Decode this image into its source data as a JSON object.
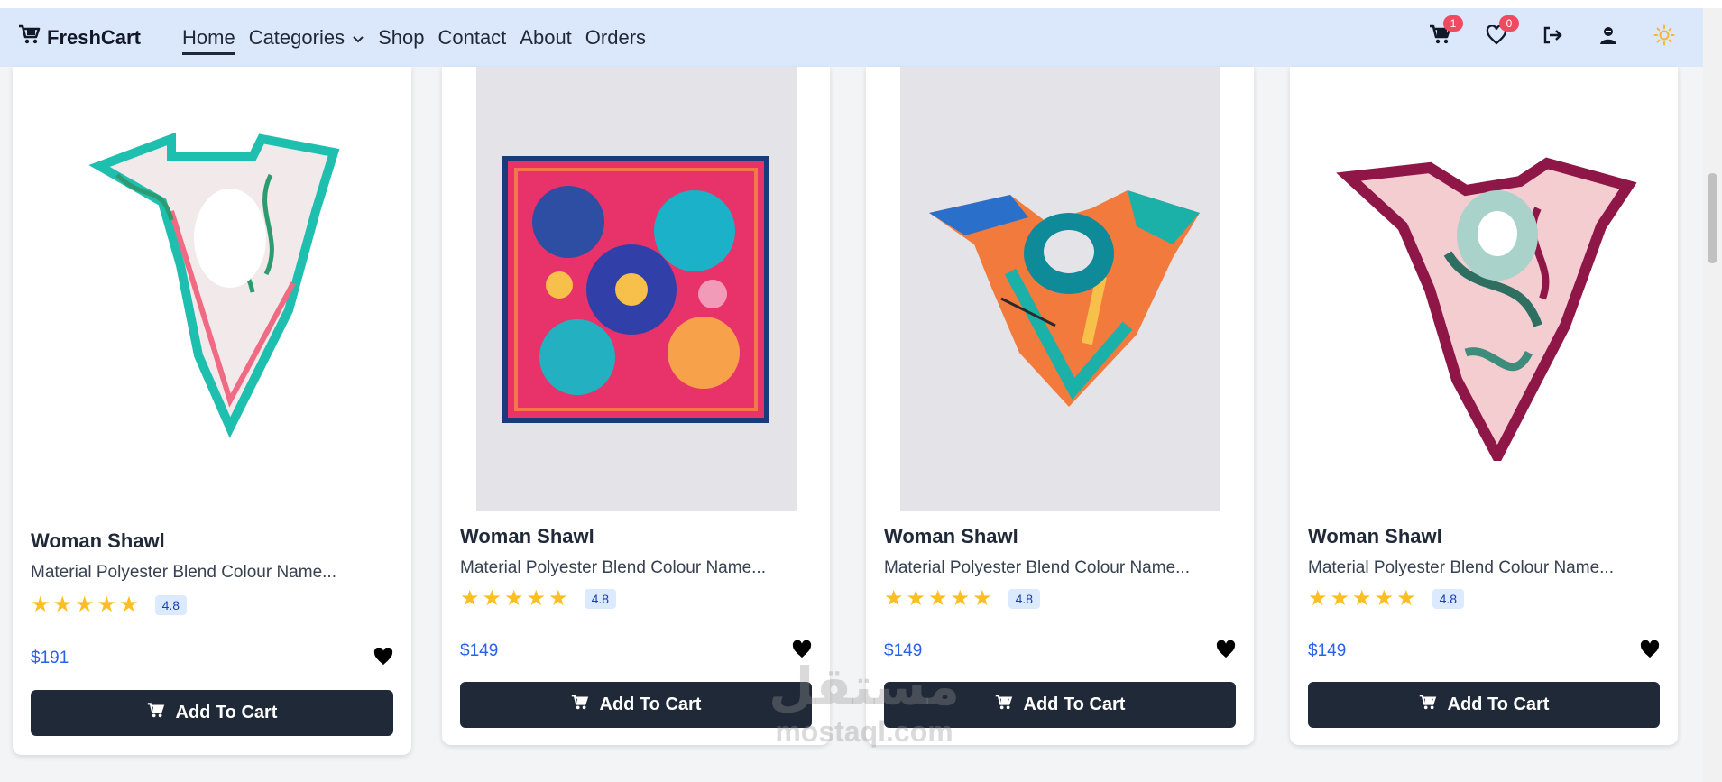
{
  "brand": {
    "name": "FreshCart"
  },
  "nav": {
    "links": [
      "Home",
      "Categories",
      "Shop",
      "Contact",
      "About",
      "Orders"
    ],
    "active": "Home"
  },
  "header_icons": {
    "cart_count": "1",
    "wishlist_count": "0",
    "icons": [
      "cart-icon",
      "heart-icon",
      "logout-icon",
      "user-icon",
      "sun-icon"
    ]
  },
  "products": [
    {
      "title": "Woman Shawl",
      "description": "Material Polyester Blend Colour Name...",
      "rating": "4.8",
      "price": "$191",
      "button": "Add To Cart"
    },
    {
      "title": "Woman Shawl",
      "description": "Material Polyester Blend Colour Name...",
      "rating": "4.8",
      "price": "$149",
      "button": "Add To Cart"
    },
    {
      "title": "Woman Shawl",
      "description": "Material Polyester Blend Colour Name...",
      "rating": "4.8",
      "price": "$149",
      "button": "Add To Cart"
    },
    {
      "title": "Woman Shawl",
      "description": "Material Polyester Blend Colour Name...",
      "rating": "4.8",
      "price": "$149",
      "button": "Add To Cart"
    }
  ],
  "watermark": {
    "arabic": "مستقل",
    "latin": "mostaql.com"
  },
  "colors": {
    "navbar_bg": "#dbe8fb",
    "button_bg": "#1f2937",
    "price": "#2563eb",
    "star": "#fbbf24",
    "badge": "#ef4a5f",
    "sun": "#f5b731"
  }
}
